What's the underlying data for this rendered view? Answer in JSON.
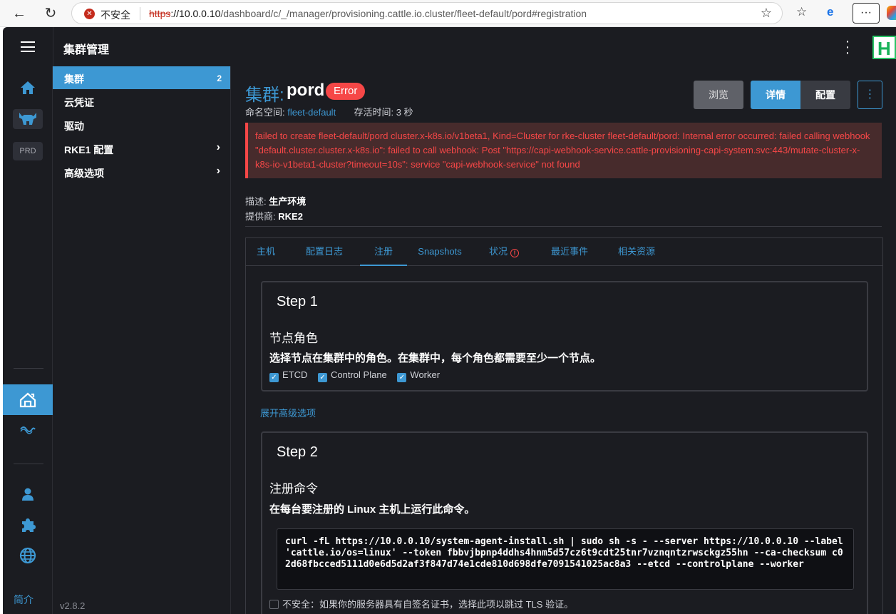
{
  "browser": {
    "security_label": "不安全",
    "url_scheme": "https",
    "url_host": "://10.0.0.10",
    "url_path": "/dashboard/c/_/manager/provisioning.cattle.io.cluster/fleet-default/pord#registration",
    "more_label": "···"
  },
  "header": {
    "title": "集群管理",
    "brand_letter": "H"
  },
  "rail": {
    "prd_label": "PRD",
    "about_label": "简介"
  },
  "sidenav": {
    "items": [
      {
        "label": "集群",
        "count": "2"
      },
      {
        "label": "云凭证"
      },
      {
        "label": "驱动"
      },
      {
        "label": "RKE1 配置"
      },
      {
        "label": "高级选项"
      }
    ],
    "version": "v2.8.2"
  },
  "cluster": {
    "title_prefix": "集群:",
    "name": "pord",
    "status": "Error",
    "namespace_label": "命名空间:",
    "namespace_value": "fleet-default",
    "age_label": "存活时间:",
    "age_value": "3 秒",
    "error_message": "failed to create fleet-default/pord cluster.x-k8s.io/v1beta1, Kind=Cluster for rke-cluster fleet-default/pord: Internal error occurred: failed calling webhook \"default.cluster.cluster.x-k8s.io\": failed to call webhook: Post \"https://capi-webhook-service.cattle-provisioning-capi-system.svc:443/mutate-cluster-x-k8s-io-v1beta1-cluster?timeout=10s\": service \"capi-webhook-service\" not found",
    "description_label": "描述:",
    "description_value": "生产环境",
    "provider_label": "提供商:",
    "provider_value": "RKE2"
  },
  "actions": {
    "browse": "浏览",
    "detail": "详情",
    "config": "配置",
    "more": "⋮"
  },
  "tabs": [
    {
      "label": "主机"
    },
    {
      "label": "配置日志"
    },
    {
      "label": "注册"
    },
    {
      "label": "Snapshots"
    },
    {
      "label": "状况"
    },
    {
      "label": "最近事件"
    },
    {
      "label": "相关资源"
    }
  ],
  "step1": {
    "title": "Step 1",
    "section_title": "节点角色",
    "section_desc": "选择节点在集群中的角色。在集群中，每个角色都需要至少一个节点。",
    "roles": [
      {
        "label": "ETCD",
        "checked": true
      },
      {
        "label": "Control Plane",
        "checked": true
      },
      {
        "label": "Worker",
        "checked": true
      }
    ]
  },
  "advanced_link": "展开高级选项",
  "step2": {
    "title": "Step 2",
    "section_title": "注册命令",
    "section_desc": "在每台要注册的 Linux 主机上运行此命令。",
    "command": "curl -fL https://10.0.0.10/system-agent-install.sh | sudo sh -s - --server https://10.0.0.10 --label 'cattle.io/os=linux' --token fbbvjbpnp4ddhs4hnm5d57cz6t9cdt25tnr7vznqntzrwsckgz55hn --ca-checksum c02d68fbcced5111d0e6d5d2af3f847d74e1cde810d698dfe7091541025ac8a3 --etcd --controlplane --worker",
    "insecure_label": "不安全：如果你的服务器具有自签名证书，选择此项以跳过 TLS 验证。"
  },
  "colors": {
    "accent": "#3d98d3",
    "error": "#f64747",
    "background": "#1b1c21"
  }
}
